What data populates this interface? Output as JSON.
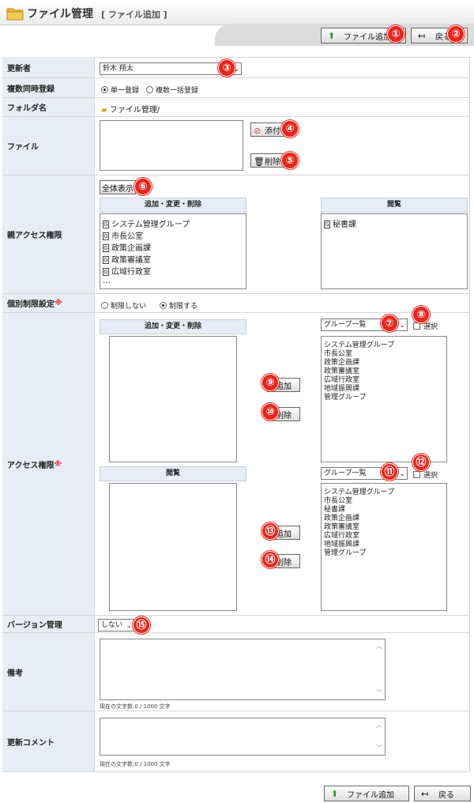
{
  "header": {
    "title": "ファイル管理",
    "subtitle": "[ ファイル追加 ]"
  },
  "toolbar": {
    "add_file_label": "ファイル追加",
    "back_label": "戻る"
  },
  "markers": [
    "①",
    "②",
    "③",
    "④",
    "⑤",
    "⑥",
    "⑦",
    "⑧",
    "⑨",
    "⑩",
    "⑪",
    "⑫",
    "⑬",
    "⑭",
    "⑮"
  ],
  "form": {
    "updater": {
      "label": "更新者",
      "value": "鈴木 翔太"
    },
    "multi_register": {
      "label": "複数同時登録",
      "options": [
        "単一登録",
        "複数一括登録"
      ],
      "selected": "単一登録"
    },
    "folder": {
      "label": "フォルダ名",
      "value": "ファイル管理/"
    },
    "file": {
      "label": "ファイル",
      "attach_label": "添付",
      "delete_label": "削除"
    },
    "parent_access": {
      "label": "親アクセス権限",
      "show_all_label": "全体表示",
      "edit_header": "追加・変更・削除",
      "edit_items": [
        "システム管理グループ",
        "市長公室",
        "政策企画課",
        "政策審議室",
        "広域行政室",
        "…"
      ],
      "view_header": "閲覧",
      "view_items": [
        "秘書課"
      ]
    },
    "individual_limit": {
      "label": "個別制限設定",
      "required_mark": "※",
      "options": [
        "制限しない",
        "制限する"
      ],
      "selected": "制限する"
    },
    "access": {
      "label": "アクセス権限",
      "required_mark": "※",
      "edit_header": "追加・変更・削除",
      "view_header": "閲覧",
      "group_select": "グループ一覧",
      "select_label": "選択",
      "add_label": "追加",
      "delete_label": "削除",
      "edit_group_list": [
        "システム管理グループ",
        "市長公室",
        "政策企画課",
        "政策審議室",
        "広域行政室",
        "地域振興課",
        "管理グループ"
      ],
      "view_group_list": [
        "システム管理グループ",
        "市長公室",
        "秘書課",
        "政策企画課",
        "政策審議室",
        "広域行政室",
        "地域振興課",
        "管理グループ"
      ]
    },
    "version": {
      "label": "バージョン管理",
      "value": "しない"
    },
    "remarks": {
      "label": "備考",
      "counter": "現在の文字数:0 / 1000 文字"
    },
    "comment": {
      "label": "更新コメント",
      "counter": "現在の文字数:0 / 1000 文字"
    }
  },
  "colors": {
    "marker": "#e8261c",
    "label_bg": "#e7ecf6",
    "required": "#e03030"
  }
}
